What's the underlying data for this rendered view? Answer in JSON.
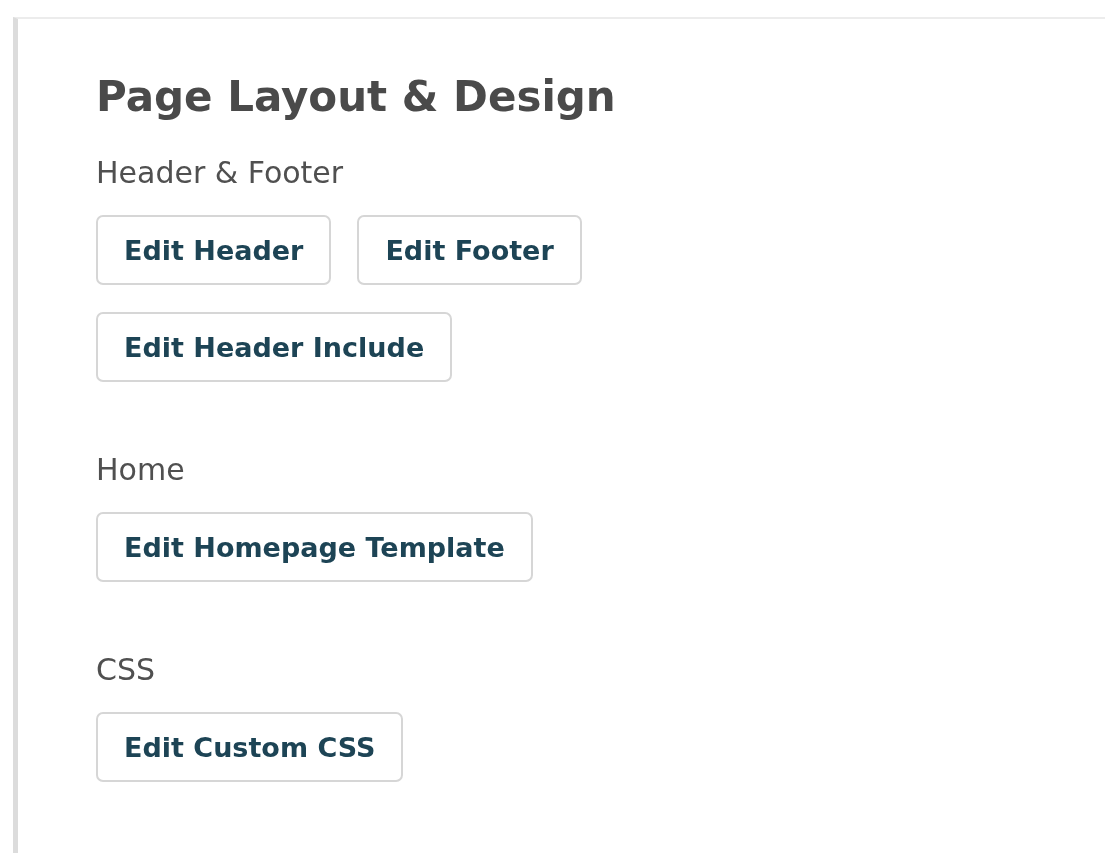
{
  "title": "Page Layout & Design",
  "sections": [
    {
      "label": "Header & Footer",
      "buttons": [
        "Edit Header",
        "Edit Footer",
        "Edit Header Include"
      ]
    },
    {
      "label": "Home",
      "buttons": [
        "Edit Homepage Template"
      ]
    },
    {
      "label": "CSS",
      "buttons": [
        "Edit Custom CSS"
      ]
    }
  ]
}
